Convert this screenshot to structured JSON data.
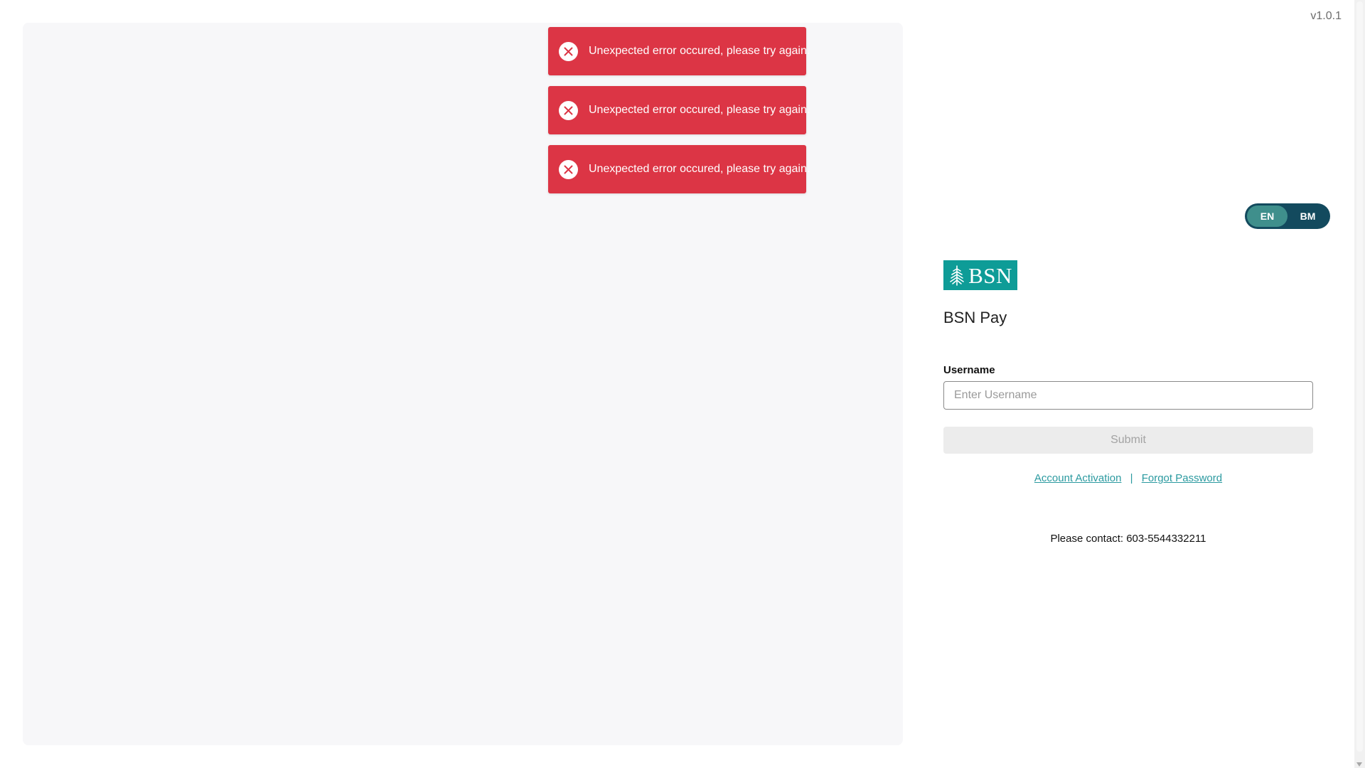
{
  "app": {
    "version": "v1.0.1",
    "title": "BSN Pay",
    "logo_text": "BSN"
  },
  "toasts": [
    {
      "message": "Unexpected error occured, please try again.",
      "icon": "close-icon"
    },
    {
      "message": "Unexpected error occured, please try again.",
      "icon": "close-icon"
    },
    {
      "message": "Unexpected error occured, please try again.",
      "icon": "close-icon"
    }
  ],
  "language": {
    "options": [
      "EN",
      "BM"
    ],
    "selected": "EN"
  },
  "form": {
    "username_label": "Username",
    "username_placeholder": "Enter Username",
    "username_value": "",
    "submit_label": "Submit"
  },
  "links": {
    "activation": "Account Activation",
    "separator": "|",
    "forgot": "Forgot Password"
  },
  "contact_text": "Please contact: 603-5544332211",
  "colors": {
    "toast_error": "#dc3545",
    "brand_teal": "#0e9c97",
    "toggle_dark": "#134a5e",
    "toggle_active": "#3f8f8c",
    "link": "#2b9aa0"
  }
}
